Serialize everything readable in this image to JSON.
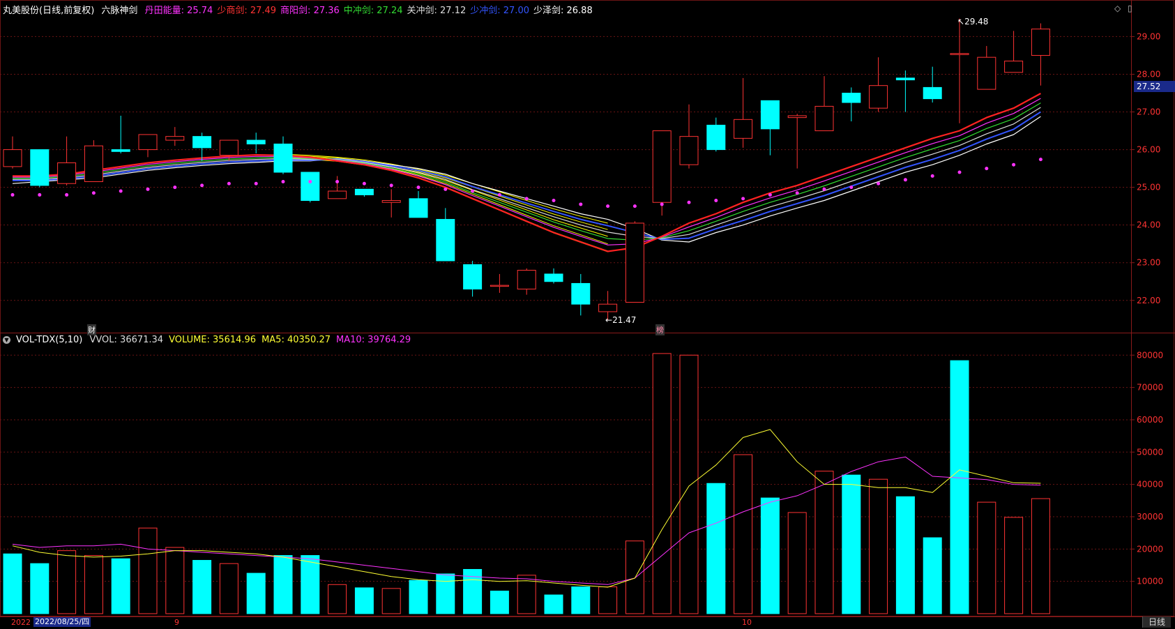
{
  "header": {
    "stock": "丸美股份(日线,前复权)",
    "indicator_name": "六脉神剑",
    "items": [
      {
        "label": "丹田能量: ",
        "value": "25.74",
        "color": "#ff33ff"
      },
      {
        "label": "少商剑: ",
        "value": "27.49",
        "color": "#ff3333"
      },
      {
        "label": "商阳剑: ",
        "value": "27.36",
        "color": "#ff33ff"
      },
      {
        "label": "中冲剑: ",
        "value": "27.24",
        "color": "#33dd33"
      },
      {
        "label": "关冲剑: ",
        "value": "27.12",
        "color": "#dddddd"
      },
      {
        "label": "少冲剑: ",
        "value": "27.00",
        "color": "#3355ff"
      },
      {
        "label": "少泽剑: ",
        "value": "26.88",
        "color": "#ffffff"
      }
    ]
  },
  "vol_header": {
    "name": "VOL-TDX(5,10)",
    "items": [
      {
        "label": "VVOL: ",
        "value": "36671.34",
        "color": "#dddddd"
      },
      {
        "label": "VOLUME: ",
        "value": "35614.96",
        "color": "#ffff33"
      },
      {
        "label": "MA5: ",
        "value": "40350.27",
        "color": "#ffff33"
      },
      {
        "label": "MA10: ",
        "value": "39764.29",
        "color": "#ff33ff"
      }
    ]
  },
  "annotations": {
    "high": "29.48",
    "low": "21.47",
    "current_price": "27.52",
    "marker_cai": "财",
    "marker_bang": "榜"
  },
  "xaxis": {
    "year_label": "2022",
    "cursor_date": "2022/08/25/四",
    "month9": "9",
    "month10": "10"
  },
  "period_button": "日线",
  "colors": {
    "up": "#ff3333",
    "down": "#00ffff",
    "grid": "#6b1414",
    "axis_text": "#ff3333"
  },
  "chart_data": [
    {
      "type": "candlestick",
      "title": "丸美股份(日线,前复权)",
      "ylim": [
        21.2,
        29.6
      ],
      "yticks": [
        22.0,
        23.0,
        24.0,
        25.0,
        26.0,
        27.0,
        28.0,
        29.0
      ],
      "candles": [
        {
          "o": 25.55,
          "h": 26.35,
          "l": 25.5,
          "c": 26.0
        },
        {
          "o": 26.0,
          "h": 26.0,
          "l": 25.0,
          "c": 25.05
        },
        {
          "o": 25.1,
          "h": 26.35,
          "l": 25.05,
          "c": 25.65
        },
        {
          "o": 25.15,
          "h": 26.25,
          "l": 25.15,
          "c": 26.1
        },
        {
          "o": 26.0,
          "h": 26.9,
          "l": 25.9,
          "c": 25.95
        },
        {
          "o": 26.0,
          "h": 26.4,
          "l": 25.8,
          "c": 26.4
        },
        {
          "o": 26.25,
          "h": 26.6,
          "l": 26.1,
          "c": 26.35
        },
        {
          "o": 26.35,
          "h": 26.45,
          "l": 25.7,
          "c": 26.05
        },
        {
          "o": 25.85,
          "h": 26.25,
          "l": 25.7,
          "c": 26.25
        },
        {
          "o": 26.25,
          "h": 26.45,
          "l": 25.9,
          "c": 26.15
        },
        {
          "o": 26.15,
          "h": 26.35,
          "l": 25.35,
          "c": 25.4
        },
        {
          "o": 25.4,
          "h": 25.4,
          "l": 24.6,
          "c": 24.65
        },
        {
          "o": 24.7,
          "h": 25.3,
          "l": 24.7,
          "c": 24.9
        },
        {
          "o": 24.95,
          "h": 24.95,
          "l": 24.75,
          "c": 24.8
        },
        {
          "o": 24.6,
          "h": 24.95,
          "l": 24.2,
          "c": 24.65
        },
        {
          "o": 24.7,
          "h": 24.9,
          "l": 24.2,
          "c": 24.2
        },
        {
          "o": 24.15,
          "h": 24.45,
          "l": 23.05,
          "c": 23.05
        },
        {
          "o": 22.95,
          "h": 23.05,
          "l": 22.1,
          "c": 22.3
        },
        {
          "o": 22.4,
          "h": 22.7,
          "l": 22.2,
          "c": 22.4
        },
        {
          "o": 22.3,
          "h": 22.85,
          "l": 22.15,
          "c": 22.8
        },
        {
          "o": 22.7,
          "h": 22.85,
          "l": 22.45,
          "c": 22.5
        },
        {
          "o": 22.45,
          "h": 22.7,
          "l": 21.6,
          "c": 21.9
        },
        {
          "o": 21.7,
          "h": 22.25,
          "l": 21.47,
          "c": 21.9
        },
        {
          "o": 21.95,
          "h": 24.1,
          "l": 21.95,
          "c": 24.05
        },
        {
          "o": 24.6,
          "h": 26.5,
          "l": 24.25,
          "c": 26.5
        },
        {
          "o": 25.6,
          "h": 27.2,
          "l": 25.5,
          "c": 26.35
        },
        {
          "o": 26.65,
          "h": 26.85,
          "l": 25.95,
          "c": 26.0
        },
        {
          "o": 26.3,
          "h": 27.9,
          "l": 26.05,
          "c": 26.8
        },
        {
          "o": 27.3,
          "h": 27.3,
          "l": 25.85,
          "c": 26.55
        },
        {
          "o": 26.85,
          "h": 26.95,
          "l": 25.5,
          "c": 26.9
        },
        {
          "o": 26.5,
          "h": 27.95,
          "l": 26.5,
          "c": 27.15
        },
        {
          "o": 27.5,
          "h": 27.65,
          "l": 26.75,
          "c": 27.25
        },
        {
          "o": 27.1,
          "h": 28.45,
          "l": 27.0,
          "c": 27.7
        },
        {
          "o": 27.9,
          "h": 28.1,
          "l": 27.0,
          "c": 27.85
        },
        {
          "o": 27.65,
          "h": 28.2,
          "l": 27.25,
          "c": 27.35
        },
        {
          "o": 28.55,
          "h": 29.48,
          "l": 26.7,
          "c": 28.55
        },
        {
          "o": 27.6,
          "h": 28.75,
          "l": 27.6,
          "c": 28.45
        },
        {
          "o": 28.05,
          "h": 29.15,
          "l": 28.05,
          "c": 28.35
        },
        {
          "o": 28.5,
          "h": 29.35,
          "l": 27.7,
          "c": 29.2
        }
      ],
      "dantian_dots": [
        24.8,
        24.8,
        24.8,
        24.85,
        24.9,
        24.95,
        25.0,
        25.05,
        25.1,
        25.1,
        25.15,
        25.15,
        25.15,
        25.1,
        25.05,
        25.0,
        24.95,
        24.9,
        24.8,
        24.7,
        24.65,
        24.55,
        24.5,
        24.5,
        24.55,
        24.6,
        24.65,
        24.7,
        24.8,
        24.85,
        24.95,
        25.0,
        25.1,
        25.2,
        25.3,
        25.4,
        25.5,
        25.6,
        25.74
      ],
      "bands": [
        {
          "name": "少商剑",
          "color": "#ff2222",
          "width": 2.2,
          "values": [
            25.3,
            25.3,
            25.35,
            25.45,
            25.55,
            25.65,
            25.72,
            25.78,
            25.83,
            25.86,
            25.85,
            25.8,
            25.7,
            25.6,
            25.45,
            25.25,
            25.0,
            24.7,
            24.4,
            24.1,
            23.8,
            23.55,
            23.3,
            23.4,
            23.7,
            24.05,
            24.3,
            24.6,
            24.85,
            25.05,
            25.3,
            25.55,
            25.8,
            26.05,
            26.3,
            26.5,
            26.85,
            27.1,
            27.49
          ]
        },
        {
          "name": "商阳剑",
          "color": "#ff33ff",
          "width": 1.2,
          "values": [
            25.27,
            25.27,
            25.32,
            25.41,
            25.51,
            25.61,
            25.68,
            25.74,
            25.79,
            25.82,
            25.82,
            25.78,
            25.72,
            25.62,
            25.48,
            25.3,
            25.07,
            24.78,
            24.5,
            24.22,
            23.94,
            23.7,
            23.47,
            23.5,
            23.68,
            23.95,
            24.2,
            24.48,
            24.72,
            24.93,
            25.17,
            25.42,
            25.67,
            25.92,
            26.16,
            26.37,
            26.7,
            26.96,
            27.36
          ]
        },
        {
          "name": "中冲剑",
          "color": "#33dd33",
          "width": 1.2,
          "values": [
            25.24,
            25.24,
            25.29,
            25.37,
            25.47,
            25.57,
            25.64,
            25.7,
            25.75,
            25.78,
            25.79,
            25.76,
            25.73,
            25.64,
            25.51,
            25.35,
            25.14,
            24.86,
            24.6,
            24.34,
            24.08,
            23.85,
            23.64,
            23.6,
            23.66,
            23.85,
            24.1,
            24.36,
            24.6,
            24.81,
            25.04,
            25.29,
            25.54,
            25.79,
            26.02,
            26.24,
            26.56,
            26.82,
            27.24
          ]
        },
        {
          "name": "关冲剑",
          "color": "#dddddd",
          "width": 1.2,
          "values": [
            25.21,
            25.21,
            25.26,
            25.33,
            25.43,
            25.53,
            25.6,
            25.66,
            25.71,
            25.74,
            25.76,
            25.74,
            25.74,
            25.66,
            25.54,
            25.4,
            25.21,
            24.94,
            24.7,
            24.46,
            24.22,
            24.0,
            23.81,
            23.7,
            23.64,
            23.75,
            24.0,
            24.24,
            24.48,
            24.69,
            24.91,
            25.16,
            25.41,
            25.66,
            25.88,
            26.11,
            26.42,
            26.68,
            27.12
          ]
        },
        {
          "name": "少冲剑",
          "color": "#3355ff",
          "width": 2.0,
          "values": [
            25.18,
            25.18,
            25.23,
            25.29,
            25.39,
            25.49,
            25.56,
            25.62,
            25.67,
            25.7,
            25.73,
            25.72,
            25.75,
            25.68,
            25.57,
            25.45,
            25.28,
            25.02,
            24.8,
            24.58,
            24.36,
            24.15,
            23.98,
            23.8,
            23.62,
            23.65,
            23.9,
            24.12,
            24.36,
            24.57,
            24.78,
            25.03,
            25.28,
            25.53,
            25.74,
            25.98,
            26.28,
            26.54,
            27.0
          ]
        },
        {
          "name": "少泽剑",
          "color": "#ffffff",
          "width": 1.2,
          "values": [
            25.1,
            25.15,
            25.2,
            25.25,
            25.35,
            25.45,
            25.52,
            25.58,
            25.63,
            25.66,
            25.7,
            25.7,
            25.76,
            25.7,
            25.6,
            25.5,
            25.35,
            25.1,
            24.9,
            24.7,
            24.5,
            24.3,
            24.15,
            23.9,
            23.6,
            23.55,
            23.8,
            24.0,
            24.24,
            24.45,
            24.65,
            24.9,
            25.15,
            25.4,
            25.6,
            25.85,
            26.15,
            26.4,
            26.88
          ]
        }
      ],
      "yellow_bands": [
        [
          25.8,
          25.75,
          25.7,
          25.6,
          25.45,
          25.25,
          25.0,
          24.7,
          24.4,
          24.1,
          23.8,
          23.55,
          23.3
        ],
        [
          25.82,
          25.77,
          25.72,
          25.63,
          25.5,
          25.32,
          25.1,
          24.82,
          24.54,
          24.26,
          23.98,
          23.74,
          23.5
        ],
        [
          25.84,
          25.8,
          25.75,
          25.66,
          25.54,
          25.38,
          25.18,
          24.92,
          24.66,
          24.4,
          24.14,
          23.92,
          23.7
        ],
        [
          25.86,
          25.82,
          25.78,
          25.7,
          25.58,
          25.43,
          25.25,
          25.01,
          24.77,
          24.53,
          24.29,
          24.08,
          23.88
        ],
        [
          25.88,
          25.85,
          25.8,
          25.73,
          25.62,
          25.48,
          25.32,
          25.1,
          24.88,
          24.65,
          24.43,
          24.23,
          24.05
        ]
      ]
    },
    {
      "type": "bar",
      "title": "VOL-TDX(5,10)",
      "ylim": [
        0,
        82000
      ],
      "yticks": [
        10000,
        20000,
        30000,
        40000,
        50000,
        60000,
        70000,
        80000
      ],
      "values": [
        18500,
        15500,
        19500,
        18000,
        17000,
        26500,
        20500,
        16500,
        15500,
        12500,
        18000,
        18000,
        9000,
        8000,
        7800,
        10300,
        12300,
        13700,
        7000,
        11900,
        5800,
        8300,
        8300,
        22500,
        80500,
        80000,
        40300,
        49200,
        35800,
        31300,
        44100,
        42900,
        41600,
        36200,
        23500,
        78300,
        34500,
        29800,
        35600
      ],
      "up": [
        false,
        false,
        true,
        true,
        false,
        true,
        true,
        false,
        true,
        false,
        false,
        false,
        true,
        false,
        true,
        false,
        false,
        false,
        false,
        true,
        false,
        false,
        true,
        true,
        true,
        true,
        false,
        true,
        false,
        true,
        true,
        false,
        true,
        false,
        false,
        false,
        true,
        true,
        true
      ],
      "ma5": [
        21000,
        19000,
        18000,
        17500,
        17800,
        18500,
        19500,
        19500,
        19000,
        18500,
        17500,
        16000,
        14500,
        13000,
        11500,
        10500,
        10000,
        10500,
        10000,
        10200,
        9500,
        8800,
        8200,
        11000,
        26000,
        39500,
        46000,
        54500,
        57000,
        47000,
        40000,
        40000,
        39000,
        39000,
        37500,
        44500,
        42500,
        40500,
        40350
      ],
      "ma10": [
        21500,
        20500,
        21000,
        21000,
        21500,
        20000,
        19500,
        19000,
        18500,
        18000,
        17500,
        17000,
        16000,
        15000,
        14000,
        13000,
        12000,
        11500,
        11000,
        10800,
        10000,
        9500,
        9000,
        11000,
        18000,
        25000,
        28000,
        31500,
        34500,
        36500,
        40000,
        44000,
        47000,
        48500,
        42500,
        42000,
        41500,
        40000,
        39764
      ]
    }
  ]
}
